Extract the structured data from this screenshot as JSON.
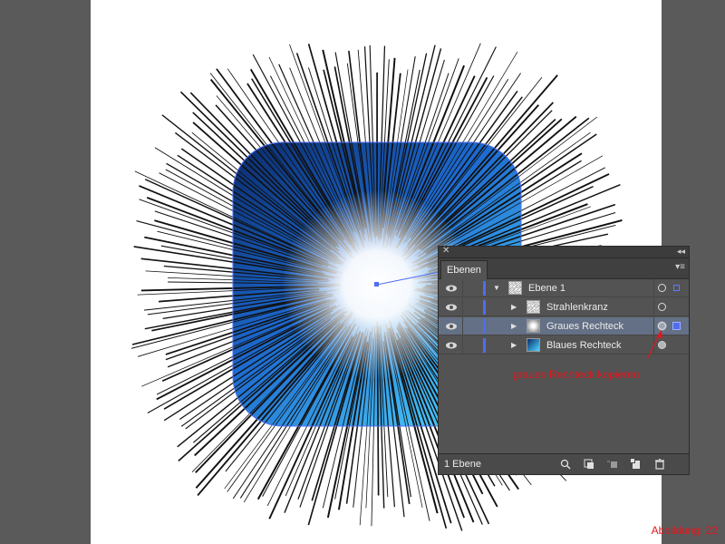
{
  "caption": "Abbildung: 22",
  "panel": {
    "title": "Ebenen",
    "footer_count": "1 Ebene",
    "layers": [
      {
        "name": "Ebene 1",
        "thumb": "starburst",
        "expanded": true,
        "selected": false,
        "indent": 0
      },
      {
        "name": "Strahlenkranz",
        "thumb": "starburst",
        "expanded": false,
        "selected": false,
        "indent": 1
      },
      {
        "name": "Graues Rechteck",
        "thumb": "gray-gradient",
        "expanded": false,
        "selected": true,
        "indent": 1
      },
      {
        "name": "Blaues Rechteck",
        "thumb": "blue-gradient",
        "expanded": false,
        "selected": false,
        "indent": 1
      }
    ]
  },
  "annotation": "graues Rechteck kopieren",
  "colors": {
    "annotation": "#e0181e",
    "selection": "#4f6df0",
    "row_selected": "#647085",
    "panel_bg": "#535353",
    "workspace_bg": "#5a5a5a"
  }
}
